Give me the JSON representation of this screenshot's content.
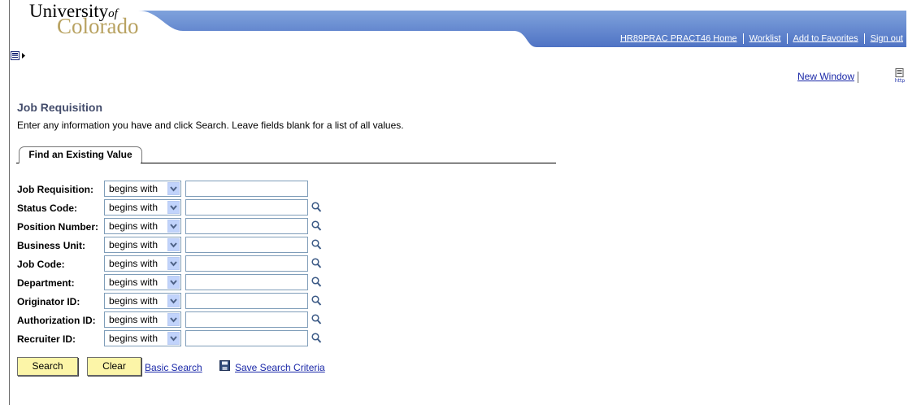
{
  "logo": {
    "line1": "University",
    "of": "of",
    "line2": "Colorado"
  },
  "header": {
    "links": [
      "HR89PRAC PRACT46 Home",
      "Worklist",
      "Add to Favorites",
      "Sign out"
    ]
  },
  "toolbar": {
    "new_window": "New Window",
    "http_icon": "http-icon"
  },
  "page": {
    "title": "Job Requisition",
    "instructions": "Enter any information you have and click Search. Leave fields blank for a list of all values."
  },
  "tab": {
    "label": "Find an Existing Value"
  },
  "fields": [
    {
      "label": "Job Requisition:",
      "operator": "begins with",
      "value": "",
      "lookup": false
    },
    {
      "label": "Status Code:",
      "operator": "begins with",
      "value": "",
      "lookup": true
    },
    {
      "label": "Position Number:",
      "operator": "begins with",
      "value": "",
      "lookup": true
    },
    {
      "label": "Business Unit:",
      "operator": "begins with",
      "value": "",
      "lookup": true
    },
    {
      "label": "Job Code:",
      "operator": "begins with",
      "value": "",
      "lookup": true
    },
    {
      "label": "Department:",
      "operator": "begins with",
      "value": "",
      "lookup": true
    },
    {
      "label": "Originator ID:",
      "operator": "begins with",
      "value": "",
      "lookup": true
    },
    {
      "label": "Authorization ID:",
      "operator": "begins with",
      "value": "",
      "lookup": true
    },
    {
      "label": "Recruiter ID:",
      "operator": "begins with",
      "value": "",
      "lookup": true
    }
  ],
  "actions": {
    "search": "Search",
    "clear": "Clear",
    "basic_search": "Basic Search",
    "save_criteria": "Save Search Criteria"
  },
  "colors": {
    "banner_blue": "#5076c8",
    "title_color": "#444d6c",
    "link_blue": "#1a28a8",
    "button_yellow": "#fcf5a8",
    "logo_gold": "#b8a261"
  }
}
